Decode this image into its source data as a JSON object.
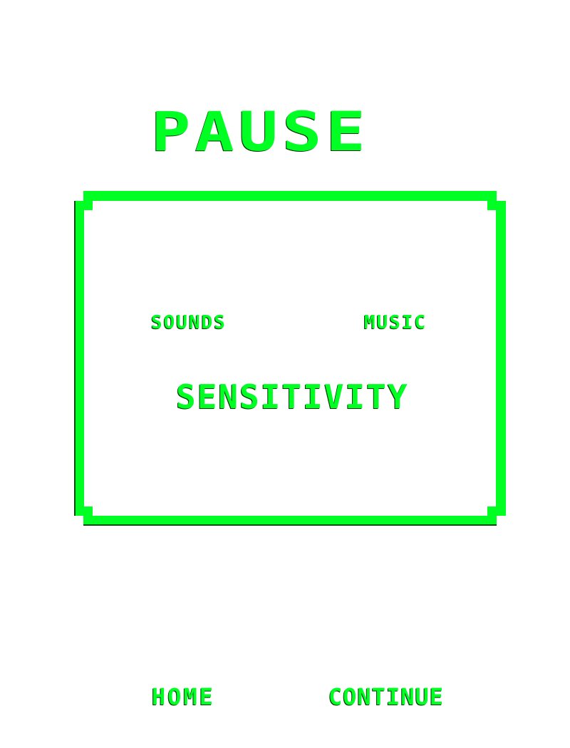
{
  "pause_menu": {
    "title": "PAUSE",
    "settings": {
      "sounds_label": "SOUNDS",
      "music_label": "MUSIC",
      "sensitivity_label": "SENSITIVITY"
    },
    "buttons": {
      "home_label": "HOME",
      "continue_label": "CONTINUE"
    }
  },
  "colors": {
    "accent": "#00ff22",
    "background": "#ffffff"
  }
}
